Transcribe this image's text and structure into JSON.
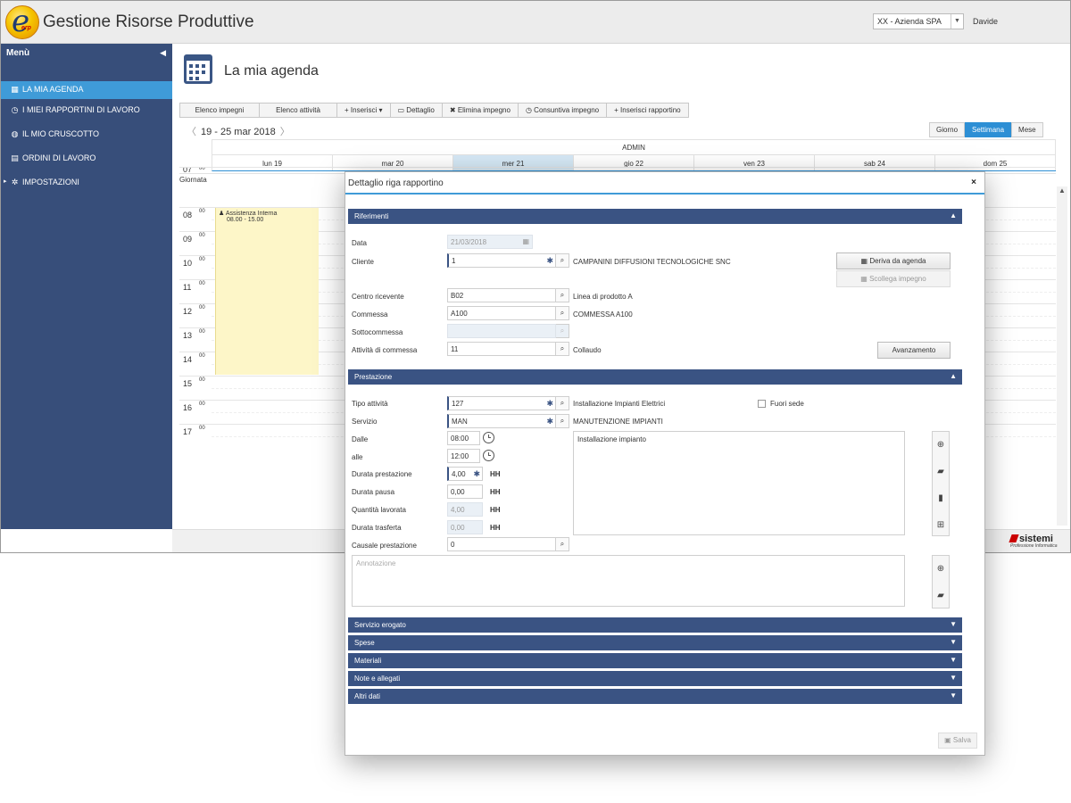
{
  "app": {
    "title": "Gestione Risorse Produttive",
    "logo_letter": "e",
    "logo_sub": "erp",
    "company": "XX - Azienda SPA",
    "user": "Davide"
  },
  "sidebar": {
    "title": "Menù",
    "items": [
      {
        "label": "LA MIA AGENDA",
        "icon": "calendar-icon",
        "glyph": "▦"
      },
      {
        "label": "I MIEI RAPPORTINI DI LAVORO",
        "icon": "clock-icon",
        "glyph": "◷"
      },
      {
        "label": "IL MIO CRUSCOTTO",
        "icon": "dashboard-icon",
        "glyph": "◍"
      },
      {
        "label": "ORDINI DI LAVORO",
        "icon": "document-icon",
        "glyph": "▤"
      },
      {
        "label": "IMPOSTAZIONI",
        "icon": "gear-icon",
        "glyph": "✲"
      }
    ]
  },
  "page": {
    "title": "La mia agenda"
  },
  "toolbar": {
    "buttons": [
      {
        "label": "Elenco impegni",
        "icon": ""
      },
      {
        "label": "Elenco attività",
        "icon": ""
      },
      {
        "label": "Inserisci",
        "icon": "+",
        "suffix": "▾"
      },
      {
        "label": "Dettaglio",
        "icon": "▭"
      },
      {
        "label": "Elimina impegno",
        "icon": "✖"
      },
      {
        "label": "Consuntiva impegno",
        "icon": "◷"
      },
      {
        "label": "Inserisci rapportino",
        "icon": "+"
      }
    ]
  },
  "calendar": {
    "range": "19 - 25 mar 2018",
    "views": [
      "Giorno",
      "Settimana",
      "Mese"
    ],
    "active_view": "Settimana",
    "user": "ADMIN",
    "days": [
      "lun 19",
      "mar 20",
      "mer 21",
      "gio 22",
      "ven 23",
      "sab 24",
      "dom 25"
    ],
    "today": "mer 21",
    "all_day_label": "Giornata",
    "hours": [
      "07",
      "08",
      "09",
      "10",
      "11",
      "12",
      "13",
      "14",
      "15",
      "16",
      "17"
    ],
    "minutes": "00",
    "appointment": {
      "title": "Assistenza Interna",
      "time": "08.00 - 15.00"
    }
  },
  "brand": {
    "name": "sistemi",
    "tagline": "Professione Informatica"
  },
  "modal": {
    "title": "Dettaglio riga rapportino",
    "close": "×",
    "sections": {
      "riferimenti": "Riferimenti",
      "prestazione": "Prestazione",
      "collapsed": [
        "Servizio erogato",
        "Spese",
        "Materiali",
        "Note e allegati",
        "Altri dati"
      ]
    },
    "riferimenti": {
      "data_label": "Data",
      "data_value": "21/03/2018",
      "cliente_label": "Cliente",
      "cliente_value": "1",
      "cliente_descr": "CAMPANINI DIFFUSIONI TECNOLOGICHE SNC",
      "deriva_button": "Deriva da agenda",
      "scollega_button": "Scollega impegno",
      "centro_label": "Centro ricevente",
      "centro_value": "B02",
      "centro_descr": "Linea di prodotto A",
      "commessa_label": "Commessa",
      "commessa_value": "A100",
      "commessa_descr": "COMMESSA A100",
      "sottocommessa_label": "Sottocommessa",
      "attivita_label": "Attività di commessa",
      "attivita_value": "11",
      "attivita_descr": "Collaudo",
      "avanzamento_button": "Avanzamento"
    },
    "prestazione": {
      "tipo_label": "Tipo attività",
      "tipo_value": "127",
      "tipo_descr": "Installazione Impianti Elettrici",
      "fuori_sede_label": "Fuori sede",
      "servizio_label": "Servizio",
      "servizio_value": "MAN",
      "servizio_descr": "MANUTENZIONE IMPIANTI",
      "dalle_label": "Dalle",
      "dalle_value": "08:00",
      "alle_label": "alle",
      "alle_value": "12:00",
      "durata_label": "Durata prestazione",
      "durata_value": "4,00",
      "pausa_label": "Durata pausa",
      "pausa_value": "0,00",
      "quantita_label": "Quantità lavorata",
      "quantita_value": "4,00",
      "trasferta_label": "Durata trasferta",
      "trasferta_value": "0,00",
      "unit": "HH",
      "causale_label": "Causale prestazione",
      "causale_value": "0",
      "descrizione_value": "Installazione impianto",
      "annotazione_placeholder": "Annotazione"
    },
    "save_button": "Salva"
  }
}
